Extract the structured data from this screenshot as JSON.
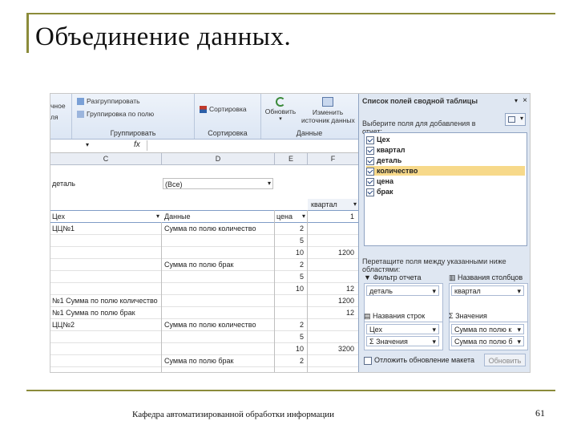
{
  "slide": {
    "title": "Объединение данных.",
    "footer": "Кафедра автоматизированной обработки информации",
    "page_number": "61"
  },
  "ribbon": {
    "clipped_left_top": "чное",
    "clipped_left_bottom": "ля",
    "ungroup_label": "Разгруппировать",
    "group_by_field_label": "Группировка по полю",
    "group_name": "Группировать",
    "sort_button": "Сортировка",
    "sort_group": "Сортировка",
    "refresh_button": "Обновить",
    "change_source_line1": "Изменить",
    "change_source_line2": "источник данных",
    "data_group": "Данные"
  },
  "formula_bar": {
    "fx": "fx"
  },
  "columns": [
    "C",
    "D",
    "E",
    "F"
  ],
  "pivot": {
    "filter_field": "деталь",
    "filter_value": "(Все)",
    "col_field_caption": "квартал",
    "row_field_caption": "Цех",
    "data_caption": "Данные",
    "price_caption": "цена",
    "col_item_1": "1",
    "rows": [
      {
        "a": "ЦЦ№1",
        "b": "Сумма по полю количество",
        "c": "2",
        "d": ""
      },
      {
        "a": "",
        "b": "",
        "c": "5",
        "d": ""
      },
      {
        "a": "",
        "b": "",
        "c": "10",
        "d": "1200"
      },
      {
        "a": "",
        "b": "Сумма по полю брак",
        "c": "2",
        "d": ""
      },
      {
        "a": "",
        "b": "",
        "c": "5",
        "d": ""
      },
      {
        "a": "",
        "b": "",
        "c": "10",
        "d": "12"
      },
      {
        "a": "№1 Сумма по полю количество",
        "b": "",
        "c": "",
        "d": "1200"
      },
      {
        "a": "№1 Сумма по полю брак",
        "b": "",
        "c": "",
        "d": "12"
      },
      {
        "a": "ЦЦ№2",
        "b": "Сумма по полю количество",
        "c": "2",
        "d": ""
      },
      {
        "a": "",
        "b": "",
        "c": "5",
        "d": ""
      },
      {
        "a": "",
        "b": "",
        "c": "10",
        "d": "3200"
      },
      {
        "a": "",
        "b": "Сумма по полю брак",
        "c": "2",
        "d": ""
      }
    ]
  },
  "field_list": {
    "title": "Список полей сводной таблицы",
    "choose_prompt": "Выберите поля для добавления в отчет:",
    "fields": [
      {
        "label": "Цех",
        "checked": true,
        "highlight": false
      },
      {
        "label": "квартал",
        "checked": true,
        "highlight": false
      },
      {
        "label": "деталь",
        "checked": true,
        "highlight": false
      },
      {
        "label": "количество",
        "checked": true,
        "highlight": true
      },
      {
        "label": "цена",
        "checked": true,
        "highlight": false
      },
      {
        "label": "брак",
        "checked": true,
        "highlight": false
      }
    ],
    "drag_prompt": "Перетащите поля между указанными ниже областями:",
    "zone_report_filter": "Фильтр отчета",
    "zone_column_labels": "Названия столбцов",
    "zone_row_labels": "Названия строк",
    "zone_values": "Значения",
    "filter_item": "деталь",
    "column_item": "квартал",
    "row_item_1": "Цех",
    "row_item_2": "Значения",
    "value_item_1": "Сумма по полю к",
    "value_item_2": "Сумма по полю б",
    "defer_update": "Отложить обновление макета",
    "update_button": "Обновить"
  },
  "colors": {
    "accent_frame": "#8b8b3a",
    "highlight_field": "#f7d98a",
    "pane_bg": "#dfe7f2"
  }
}
